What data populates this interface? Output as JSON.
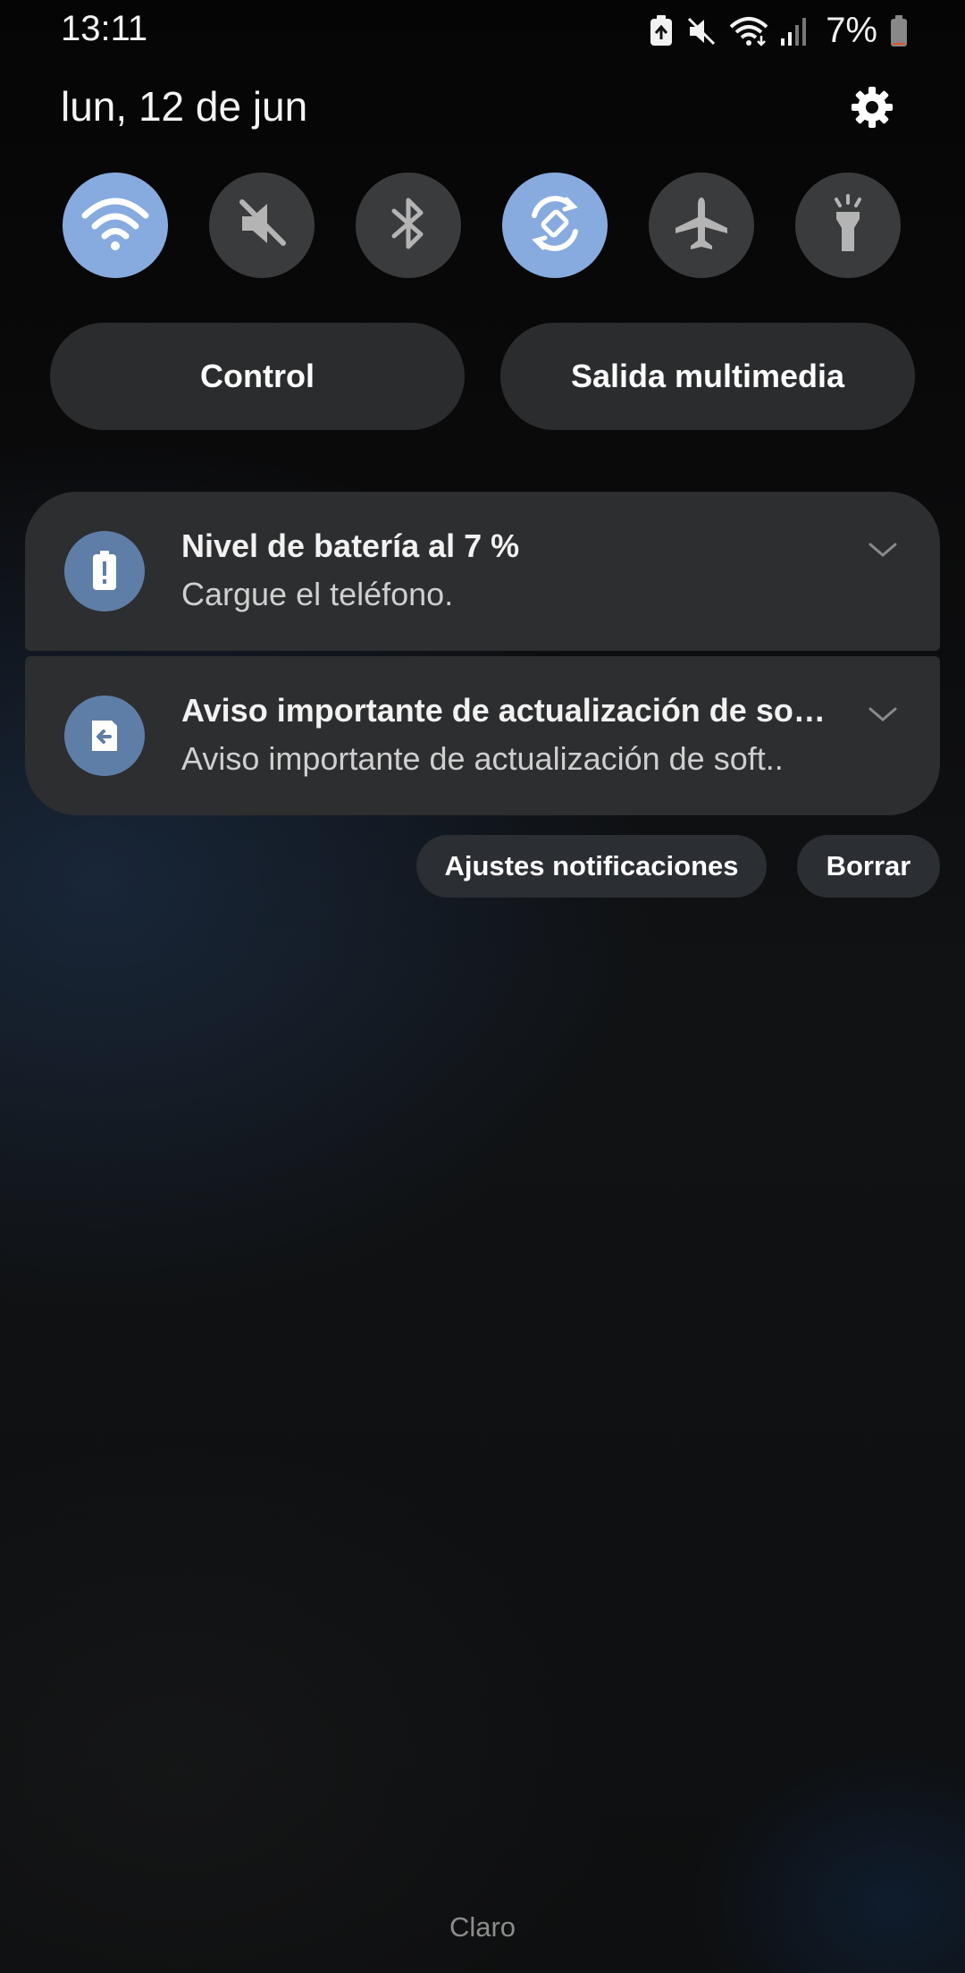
{
  "status_bar": {
    "time": "13:11",
    "battery_percent": "7%",
    "battery_level": 0.07,
    "icons": [
      "battery-saver-icon",
      "mute-icon",
      "wifi-icon",
      "signal-icon",
      "battery-icon"
    ]
  },
  "header": {
    "date": "lun, 12 de jun",
    "settings_icon": "gear-icon"
  },
  "quick_toggles": [
    {
      "name": "wifi",
      "icon": "wifi-icon",
      "active": true
    },
    {
      "name": "sound",
      "icon": "mute-icon",
      "active": false
    },
    {
      "name": "bluetooth",
      "icon": "bluetooth-icon",
      "active": false
    },
    {
      "name": "auto-rotate",
      "icon": "rotate-icon",
      "active": true
    },
    {
      "name": "airplane-mode",
      "icon": "airplane-icon",
      "active": false
    },
    {
      "name": "flashlight",
      "icon": "flashlight-icon",
      "active": false
    }
  ],
  "buttons": {
    "control": "Control",
    "media_output": "Salida multimedia"
  },
  "notifications": [
    {
      "icon": "battery-alert-icon",
      "title": "Nivel de batería al 7 %",
      "body": "Cargue el teléfono."
    },
    {
      "icon": "software-update-icon",
      "title": "Aviso importante de actualización de so…",
      "body": "Aviso importante de actualización de soft.."
    }
  ],
  "notification_actions": {
    "settings": "Ajustes notificaciones",
    "clear": "Borrar"
  },
  "carrier": "Claro",
  "colors": {
    "toggle_active": "#87abde",
    "toggle_inactive": "#3a3b3d",
    "card_background": "#2d2e30",
    "notification_icon": "#5f7ea7",
    "battery_low": "#e0552b"
  }
}
